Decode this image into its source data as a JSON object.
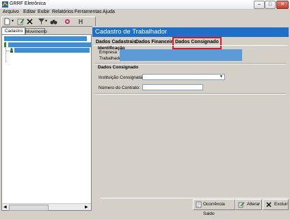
{
  "window": {
    "title": "GRRF Eletrônica",
    "minimize": "‒",
    "maximize": "□",
    "close": "✕"
  },
  "menu": [
    "Arquivo",
    "Editar",
    "Exibir",
    "Relatórios",
    "Ferramentas",
    "Ajuda"
  ],
  "left_tabs": {
    "cadastro": "Cadastro",
    "movimento": "Movimento"
  },
  "header": {
    "title": "Cadastro de Trabalhador"
  },
  "tabs": {
    "dados_cadastrais": "Dados Cadastrais",
    "dados_financeiros": "Dados Financeiros",
    "dados_consignado": "Dados Consignado"
  },
  "identificacao": {
    "title": "Identificação",
    "empresa_label": "Empresa",
    "trabalhador_label": "Trabalhador"
  },
  "consignado": {
    "title": "Dados Consignado",
    "instituicao_label": "Instituição Consignatária:",
    "instituicao_value": "",
    "contrato_label": "Número do Contrato:",
    "contrato_value": ""
  },
  "buttons": {
    "ocorrencia": "Ocorrência Saldo",
    "alterar": "Alterar",
    "excluir": "Excluir"
  },
  "colors": {
    "header": "#1f6fc6",
    "highlight": "#3a8fd8",
    "active_tab_border": "#e0141c"
  }
}
